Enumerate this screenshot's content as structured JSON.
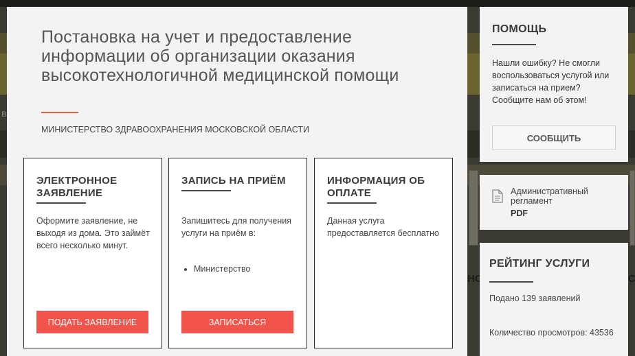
{
  "service": {
    "title": "Постановка на учет и предоставление информации об организации оказания высокотехнологичной медицинской помощи",
    "organization": "МИНИСТЕРСТВО ЗДРАВООХРАНЕНИЯ МОСКОВСКОЙ ОБЛАСТИ"
  },
  "cards": [
    {
      "title": "ЭЛЕКТРОННОЕ ЗАЯВЛЕНИЕ",
      "text": "Оформите заявление, не выходя из дома. Это займёт всего несколько минут.",
      "button": "ПОДАТЬ ЗАЯВЛЕНИЕ"
    },
    {
      "title": "ЗАПИСЬ НА ПРИЁМ",
      "text": "Запишитесь для получения услуги на приём в:",
      "list": [
        "Министерство"
      ],
      "button": "ЗАПИСАТЬСЯ"
    },
    {
      "title": "ИНФОРМАЦИЯ ОБ ОПЛАТЕ",
      "text": "Данная услуга предоставляется бесплатно"
    }
  ],
  "help": {
    "title": "ПОМОЩЬ",
    "text": "Нашли ошибку? Не смогли воспользоваться услугой или записаться на прием? Сообщите нам об этом!",
    "button": "СООБЩИТЬ"
  },
  "document": {
    "icon": "document-icon",
    "label": "Административный регламент",
    "format": "PDF"
  },
  "rating": {
    "title": "РЕЙТИНГ УСЛУГИ",
    "applications": "Подано 139 заявлений",
    "views": "Количество просмотров: 43536"
  },
  "background": {
    "left_fragment": "в",
    "right_fragment": "НС",
    "right_fragment2": "С"
  },
  "colors": {
    "accent": "#f2534a",
    "panel": "#f3f3f3",
    "overlay": "#3a3a33"
  }
}
